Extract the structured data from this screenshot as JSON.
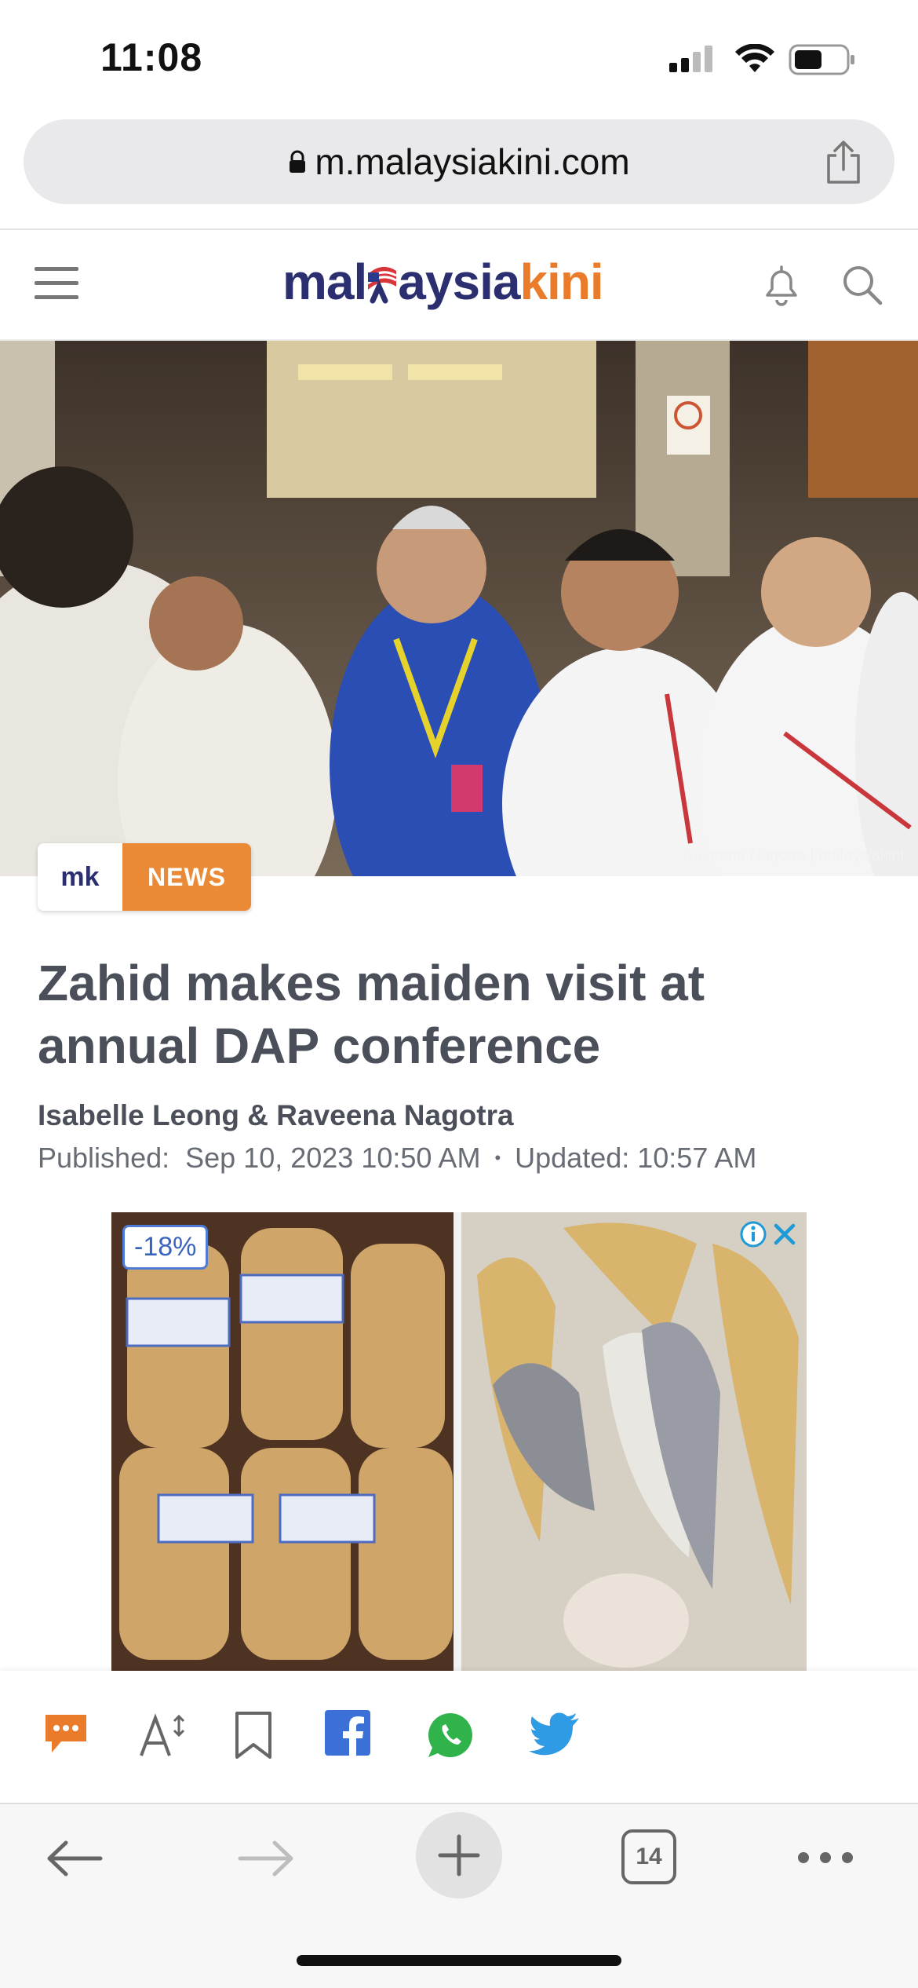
{
  "status_bar": {
    "time": "11:08"
  },
  "browser": {
    "url": "m.malaysiakini.com",
    "tab_count": "14"
  },
  "site": {
    "logo_part1": "mal",
    "logo_part2": "aysia",
    "logo_part3": "kini"
  },
  "hero": {
    "photo_credit": "Raveena Nagotra | malaysiakini"
  },
  "badge": {
    "brand": "mk",
    "category": "NEWS"
  },
  "article": {
    "headline": "Zahid makes maiden visit at annual DAP conference",
    "authors": "Isabelle Leong & Raveena Nagotra",
    "published_label": "Published:",
    "published": "Sep 10, 2023 10:50 AM",
    "separator": "•",
    "updated_label": "Updated:",
    "updated": "10:57 AM"
  },
  "ad": {
    "discount": "-18%"
  },
  "icons": {
    "comments": "comment-icon",
    "text_size": "text-size-icon",
    "bookmark": "bookmark-icon",
    "facebook": "facebook-icon",
    "whatsapp": "whatsapp-icon",
    "twitter": "twitter-icon"
  },
  "colors": {
    "brand_navy": "#2b2f6f",
    "brand_orange": "#ea7b2a",
    "facebook": "#3b70d6",
    "whatsapp": "#2fb34a",
    "twitter": "#2f9be4"
  }
}
